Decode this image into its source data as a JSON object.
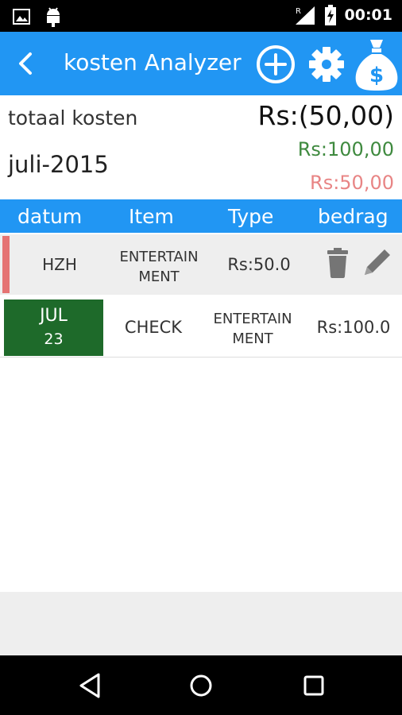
{
  "status_bar": {
    "time": "00:01",
    "signal_badge": "R"
  },
  "app_bar": {
    "title": "kosten Analyzer"
  },
  "summary": {
    "total_label": "totaal kosten",
    "month": "juli-2015",
    "total_value": "Rs:(50,00)",
    "income_value": "Rs:100,00",
    "expense_value": "Rs:50,00"
  },
  "table": {
    "columns": [
      "datum",
      "Item",
      "Type",
      "bedrag"
    ],
    "rows": [
      {
        "date_month": "",
        "date_day": "",
        "item": "HZH",
        "type_line1": "ENTERTAIN",
        "type_line2": "MENT",
        "amount": "Rs:50.0"
      },
      {
        "date_month": "JUL",
        "date_day": "23",
        "item": "CHECK",
        "type_line1": "ENTERTAIN",
        "type_line2": "MENT",
        "amount": "Rs:100.0"
      }
    ]
  },
  "colors": {
    "primary": "#2196f3",
    "income": "#3f8a3f",
    "expense": "#e88585",
    "date_badge": "#1e6a2a",
    "row_marker": "#e57373"
  },
  "icons": [
    "image-icon",
    "android-icon",
    "signal-icon",
    "battery-icon",
    "back-icon",
    "add-icon",
    "gear-icon",
    "money-bag-icon",
    "trash-icon",
    "pencil-icon",
    "nav-back-icon",
    "nav-home-icon",
    "nav-recents-icon"
  ]
}
